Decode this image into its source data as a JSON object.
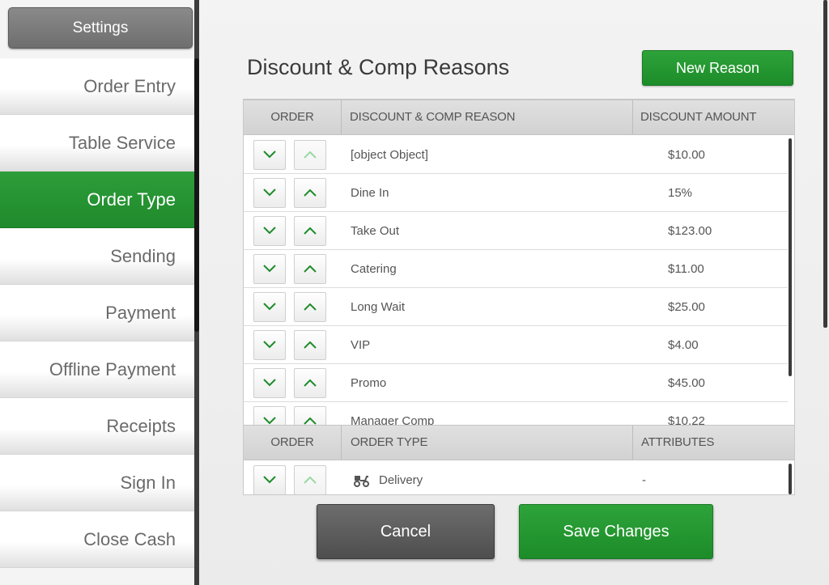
{
  "sidebar": {
    "settings_label": "Settings",
    "items": [
      {
        "label": "Order Entry",
        "active": false
      },
      {
        "label": "Table Service",
        "active": false
      },
      {
        "label": "Order Type",
        "active": true
      },
      {
        "label": "Sending",
        "active": false
      },
      {
        "label": "Payment",
        "active": false
      },
      {
        "label": "Offline Payment",
        "active": false
      },
      {
        "label": "Receipts",
        "active": false
      },
      {
        "label": "Sign In",
        "active": false
      },
      {
        "label": "Close Cash",
        "active": false
      }
    ]
  },
  "main": {
    "title": "Discount & Comp Reasons",
    "new_reason_label": "New Reason",
    "discount_table": {
      "headers": [
        "ORDER",
        "DISCOUNT & COMP REASON",
        "DISCOUNT AMOUNT"
      ],
      "rows": [
        {
          "name": "[object Object]",
          "amount": "$10.00",
          "up_enabled": false
        },
        {
          "name": "Dine In",
          "amount": "15%",
          "up_enabled": true
        },
        {
          "name": "Take Out",
          "amount": "$123.00",
          "up_enabled": true
        },
        {
          "name": "Catering",
          "amount": "$11.00",
          "up_enabled": true
        },
        {
          "name": "Long Wait",
          "amount": "$25.00",
          "up_enabled": true
        },
        {
          "name": "VIP",
          "amount": "$4.00",
          "up_enabled": true
        },
        {
          "name": "Promo",
          "amount": "$45.00",
          "up_enabled": true
        },
        {
          "name": "Manager Comp",
          "amount": "$10.22",
          "up_enabled": true
        }
      ]
    },
    "order_type_table": {
      "headers": [
        "ORDER",
        "ORDER TYPE",
        "ATTRIBUTES"
      ],
      "rows": [
        {
          "name": "Delivery",
          "attributes": "-",
          "icon": "delivery-scooter-icon",
          "up_enabled": false
        }
      ]
    },
    "cancel_label": "Cancel",
    "save_label": "Save Changes"
  },
  "colors": {
    "accent_green": "#1f8a2b",
    "button_gray": "#5e5e5e",
    "sidebar_text": "#6a6a6a"
  }
}
